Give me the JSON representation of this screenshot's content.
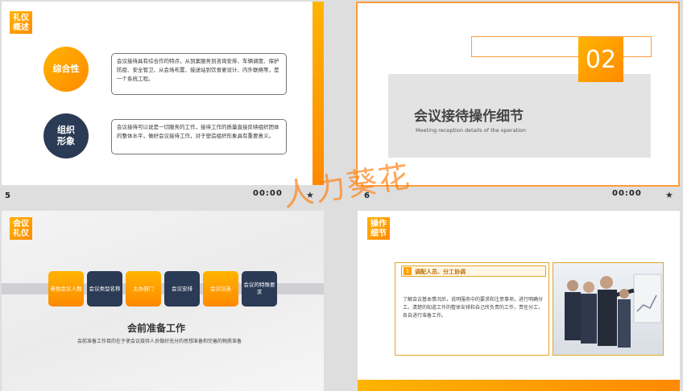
{
  "slides": {
    "s5": {
      "number": "5",
      "time": "00:00",
      "tag": "礼仪\n概述",
      "circle1": "综合性",
      "circle2": "组织\n形象",
      "box1": "会议接待具有综合作的特点，从到案服务到咨询安排、车辆调度、保护防疫、安全管卫、从会场布置、接送站到饮食宴设计、内外联络等，是一个系统工程。",
      "box2": "会议接待可以说是一切服务的工作，接待工作的质量直接反映组织团体的整体水平，做好会议接待工作，对于塑造组织形象具有重要意义。"
    },
    "s6": {
      "number": "6",
      "time": "00:00",
      "big_number": "02",
      "title": "会议接待操作细节",
      "subtitle": "Meeting reception details of the operation"
    },
    "s7": {
      "tag": "会议\n礼仪",
      "steps": [
        "参加会议人数",
        "会议类型名称",
        "主办部门",
        "会议安排",
        "会议议连",
        "会议的特殊要求"
      ],
      "title": "会前准备工作",
      "subtitle": "会前准备工作目的在于使会议接待人员做好充分的思想准备和完善的物质准备"
    },
    "s8": {
      "tag": "操作\n细节",
      "head_num": "1",
      "head_label": "调配人员、分工协调",
      "body": "了解会议基本情况后，说明服务中的要求和注意事项，进行明确分工。清楚的知道工作的整体安排和自己所负责的工作，责任分工，各自进行准备工作。"
    },
    "watermark": "人力葵花",
    "star": "★"
  }
}
